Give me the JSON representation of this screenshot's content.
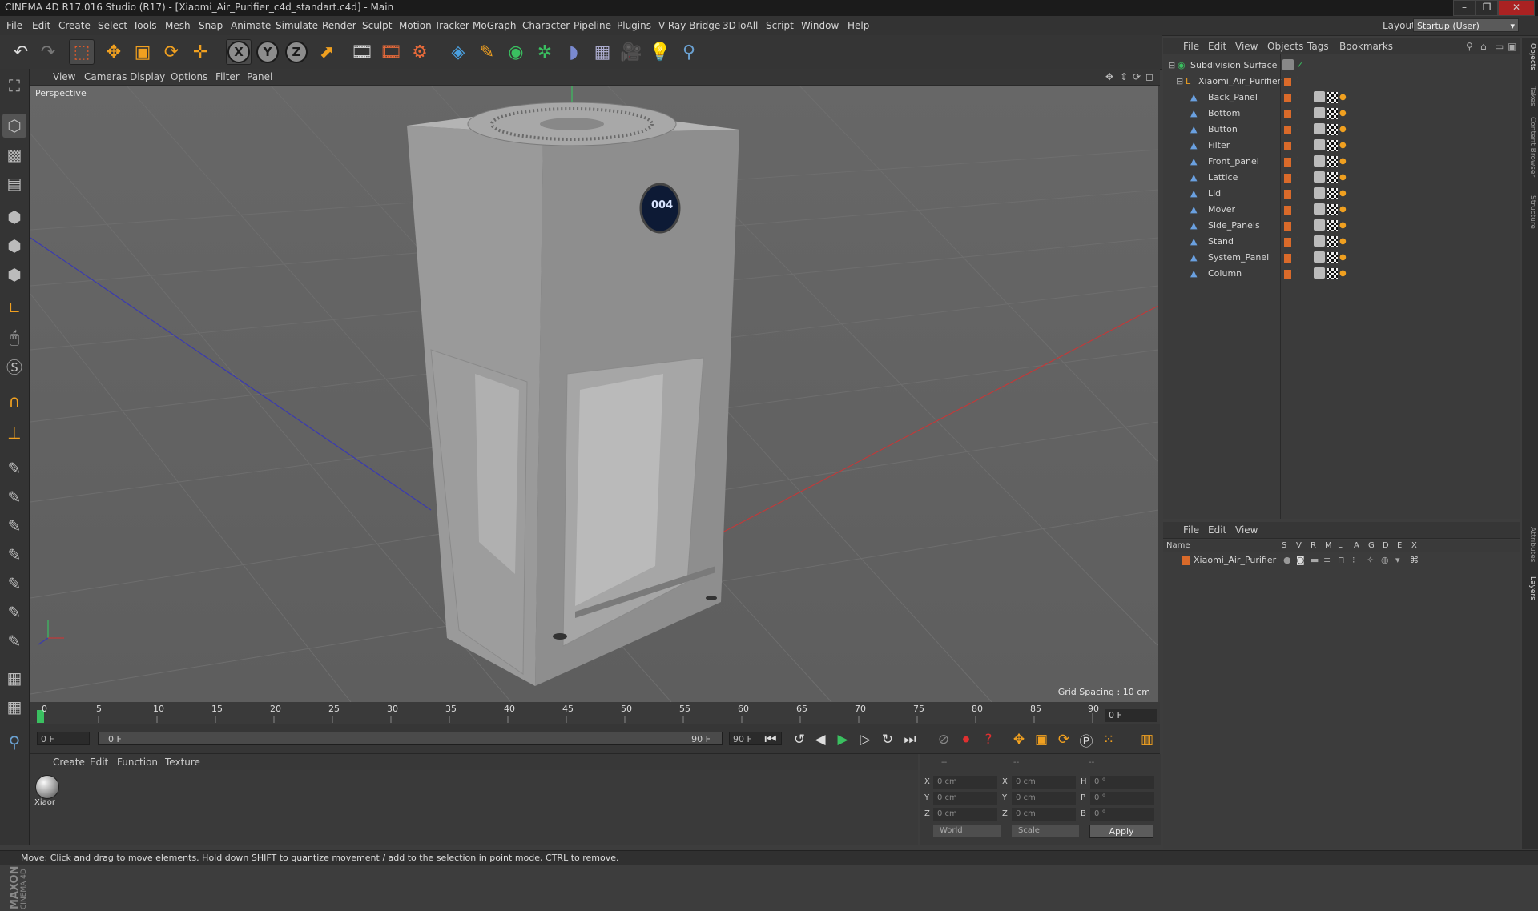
{
  "window": {
    "title": "CINEMA 4D R17.016 Studio (R17) - [Xiaomi_Air_Purifier_c4d_standart.c4d] - Main",
    "controls": [
      "–",
      "❐",
      "✕"
    ]
  },
  "menubar": {
    "items": [
      "File",
      "Edit",
      "Create",
      "Select",
      "Tools",
      "Mesh",
      "Snap",
      "Animate",
      "Simulate",
      "Render",
      "Sculpt",
      "Motion Tracker",
      "MoGraph",
      "Character",
      "Pipeline",
      "Plugins",
      "V-Ray Bridge",
      "3DToAll",
      "Script",
      "Window",
      "Help"
    ],
    "layout_label": "Layout:",
    "layout_value": "Startup (User)"
  },
  "toolbar": {
    "axis_labels": [
      "X",
      "Y",
      "Z"
    ],
    "icons": [
      "undo-icon",
      "redo-icon",
      "live-selection-icon",
      "move-icon",
      "scale-icon",
      "rotate-icon",
      "transform-icon",
      "x-axis-icon",
      "y-axis-icon",
      "z-axis-icon",
      "coordinate-system-icon",
      "render-view-icon",
      "render-picture-viewer-icon",
      "edit-render-settings-icon",
      "cube-icon",
      "pen-icon",
      "subdivision-icon",
      "cloner-icon",
      "deformer-icon",
      "floor-icon",
      "camera-icon",
      "light-icon",
      "python-icon"
    ]
  },
  "viewport": {
    "menu": [
      "View",
      "Cameras",
      "Display",
      "Options",
      "Filter",
      "Panel"
    ],
    "label": "Perspective",
    "grid_spacing": "Grid Spacing : 10 cm",
    "display_digits": "004"
  },
  "timeline": {
    "ticks": [
      "0",
      "5",
      "10",
      "15",
      "20",
      "25",
      "30",
      "35",
      "40",
      "45",
      "50",
      "55",
      "60",
      "65",
      "70",
      "75",
      "80",
      "85",
      "90"
    ],
    "current_frame_box": "0 F",
    "start_field": "0 F",
    "range_start": "0 F",
    "range_end": "90 F",
    "end_field": "90 F"
  },
  "material_manager": {
    "menu": [
      "Create",
      "Edit",
      "Function",
      "Texture"
    ],
    "material_name": "Xiaor"
  },
  "coordinates": {
    "header": [
      "--",
      "--",
      "--"
    ],
    "rows": [
      {
        "axis": "X",
        "pos": "0 cm",
        "size_axis": "X",
        "size": "0 cm",
        "rot_axis": "H",
        "rot": "0 °"
      },
      {
        "axis": "Y",
        "pos": "0 cm",
        "size_axis": "Y",
        "size": "0 cm",
        "rot_axis": "P",
        "rot": "0 °"
      },
      {
        "axis": "Z",
        "pos": "0 cm",
        "size_axis": "Z",
        "size": "0 cm",
        "rot_axis": "B",
        "rot": "0 °"
      }
    ],
    "mode_world": "World",
    "mode_scale": "Scale",
    "apply": "Apply"
  },
  "object_manager": {
    "menu": [
      "File",
      "Edit",
      "View",
      "Objects",
      "Tags",
      "Bookmarks"
    ],
    "root": "Subdivision Surface",
    "group": "Xiaomi_Air_Purifier",
    "children": [
      "Back_Panel",
      "Bottom",
      "Button",
      "Filter",
      "Front_panel",
      "Lattice",
      "Lid",
      "Mover",
      "Side_Panels",
      "Stand",
      "System_Panel",
      "Column"
    ]
  },
  "layer_manager": {
    "menu": [
      "File",
      "Edit",
      "View"
    ],
    "columns": [
      "Name",
      "S",
      "V",
      "R",
      "M",
      "L",
      "A",
      "G",
      "D",
      "E",
      "X"
    ],
    "layers": [
      "Xiaomi_Air_Purifier"
    ]
  },
  "right_tabs": [
    "Objects",
    "Takes",
    "Content Browser",
    "Structure",
    "Attributes",
    "Layers"
  ],
  "status": "Move: Click and drag to move elements. Hold down SHIFT to quantize movement / add to the selection in point mode, CTRL to remove.",
  "colors": {
    "accent_orange": "#d96a2a",
    "viewport_bg": "#626262",
    "x_axis_line": "#c03a3a",
    "z_axis_line": "#3a3ab0"
  }
}
